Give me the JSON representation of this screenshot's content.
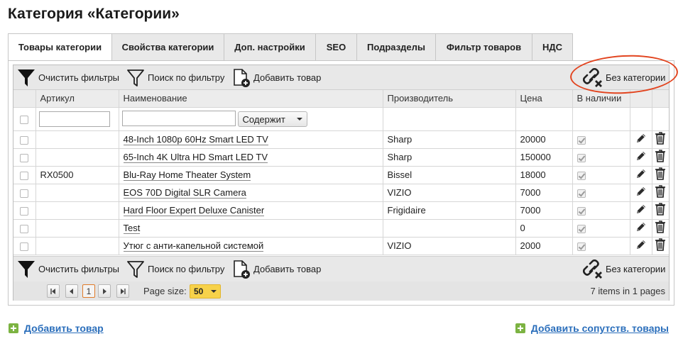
{
  "page": {
    "title": "Категория «Категории»"
  },
  "tabs": [
    {
      "label": "Товары категории",
      "active": true
    },
    {
      "label": "Свойства категории"
    },
    {
      "label": "Доп. настройки"
    },
    {
      "label": "SEO"
    },
    {
      "label": "Подразделы"
    },
    {
      "label": "Фильтр товаров"
    },
    {
      "label": "НДС"
    }
  ],
  "toolbar": {
    "clear_filters": "Очистить фильтры",
    "search_filter": "Поиск по фильтру",
    "add_product": "Добавить товар",
    "no_category": "Без категории"
  },
  "columns": {
    "article": "Артикул",
    "name": "Наименование",
    "manufacturer": "Производитель",
    "price": "Цена",
    "in_stock": "В наличии"
  },
  "filter": {
    "article_value": "",
    "name_value": "",
    "name_operator": "Содержит"
  },
  "rows": [
    {
      "article": "",
      "name": "48-Inch 1080p 60Hz Smart LED TV",
      "manufacturer": "Sharp",
      "price": "20000",
      "in_stock": true
    },
    {
      "article": "",
      "name": "65-Inch 4K Ultra HD Smart LED TV",
      "manufacturer": "Sharp",
      "price": "150000",
      "in_stock": true
    },
    {
      "article": "RX0500",
      "name": "Blu-Ray Home Theater System",
      "manufacturer": "Bissel",
      "price": "18000",
      "in_stock": true
    },
    {
      "article": "",
      "name": "EOS 70D Digital SLR Camera",
      "manufacturer": "VIZIO",
      "price": "7000",
      "in_stock": true
    },
    {
      "article": "",
      "name": "Hard Floor Expert Deluxe Canister",
      "manufacturer": "Frigidaire",
      "price": "7000",
      "in_stock": true
    },
    {
      "article": "",
      "name": "Test",
      "manufacturer": "",
      "price": "0",
      "in_stock": true
    },
    {
      "article": "",
      "name": "Утюг с анти-капельной системой",
      "manufacturer": "VIZIO",
      "price": "2000",
      "in_stock": true
    }
  ],
  "pager": {
    "current_page": "1",
    "page_size_label": "Page size:",
    "page_size": "50",
    "summary": "7 items in 1 pages"
  },
  "footer": {
    "add_product": "Добавить товар",
    "add_related": "Добавить сопутств. товары"
  },
  "colors": {
    "accent_link": "#2a6ebb",
    "plus_green": "#7cb342",
    "highlight": "#e2441f",
    "page_size_bg": "#f7d24a"
  },
  "icons": [
    "funnel-black-icon",
    "funnel-outline-icon",
    "add-document-icon",
    "unlink-icon",
    "edit-pencil-icon",
    "trash-icon",
    "first-page-icon",
    "prev-page-icon",
    "next-page-icon",
    "last-page-icon",
    "plus-icon"
  ]
}
